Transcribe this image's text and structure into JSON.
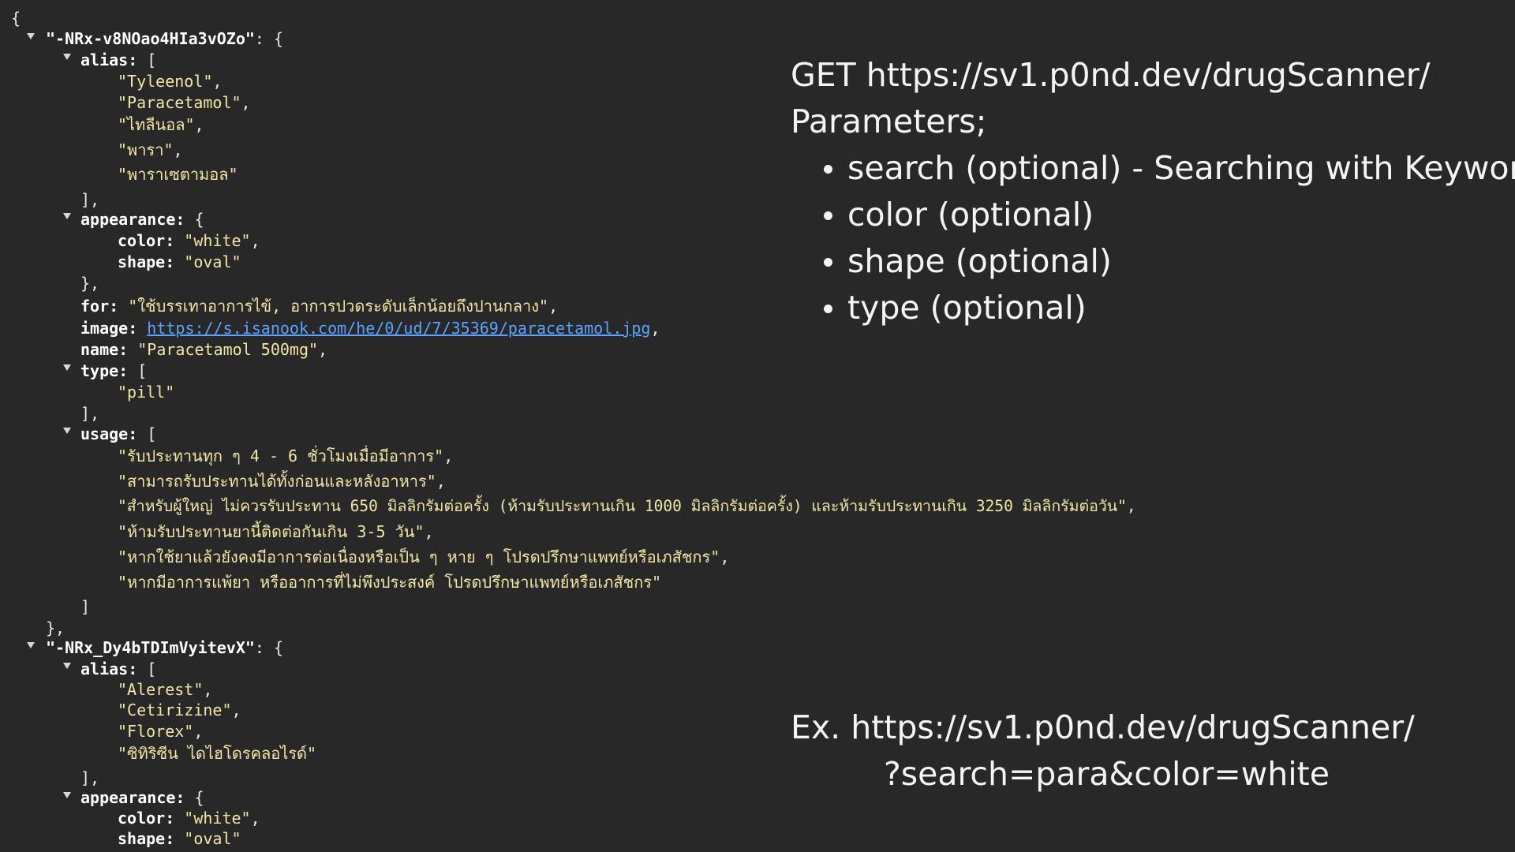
{
  "json_view": {
    "open_brace": "{",
    "entries": [
      {
        "key": "\"-NRx-v8NOao4HIa3vOZo\"",
        "alias_key": "alias:",
        "alias": [
          "\"Tyleenol\"",
          "\"Paracetamol\"",
          "\"ไทลีนอล\"",
          "\"พารา\"",
          "\"พาราเซตามอล\""
        ],
        "appearance_key": "appearance:",
        "color_key": "color:",
        "color_value": "\"white\"",
        "shape_key": "shape:",
        "shape_value": "\"oval\"",
        "for_key": "for:",
        "for_value": "\"ใช้บรรเทาอาการไข้, อาการปวดระดับเล็กน้อยถึงปานกลาง\"",
        "image_key": "image:",
        "image_value": "https://s.isanook.com/he/0/ud/7/35369/paracetamol.jpg",
        "name_key": "name:",
        "name_value": "\"Paracetamol 500mg\"",
        "type_key": "type:",
        "type": [
          "\"pill\""
        ],
        "usage_key": "usage:",
        "usage": [
          "\"รับประทานทุก ๆ 4 - 6 ชั่วโมงเมื่อมีอาการ\"",
          "\"สามารถรับประทานได้ทั้งก่อนและหลังอาหาร\"",
          "\"สำหรับผู้ใหญ่ ไม่ควรรับประทาน 650 มิลลิกรัมต่อครั้ง (ห้ามรับประทานเกิน 1000 มิลลิกรัมต่อครั้ง) และห้ามรับประทานเกิน 3250 มิลลิกรัมต่อวัน\"",
          "\"ห้ามรับประทานยานี้ติดต่อกันเกิน 3-5 วัน\"",
          "\"หากใช้ยาแล้วยังคงมีอาการต่อเนื่องหรือเป็น ๆ หาย ๆ โปรดปรึกษาแพทย์หรือเภสัชกร\"",
          "\"หากมีอาการแพ้ยา หรืออาการที่ไม่พึงประสงค์ โปรดปรึกษาแพทย์หรือเภสัชกร\""
        ]
      },
      {
        "key": "\"-NRx_Dy4bTDImVyitevX\"",
        "alias_key": "alias:",
        "alias": [
          "\"Alerest\"",
          "\"Cetirizine\"",
          "\"Florex\"",
          "\"ซิทิริซีน ไดไฮโดรคลอไรด์\""
        ],
        "appearance_key": "appearance:",
        "color_key": "color:",
        "color_value": "\"white\"",
        "shape_key": "shape:",
        "shape_value": "\"oval\""
      }
    ]
  },
  "api_doc": {
    "endpoint": "GET https://sv1.p0nd.dev/drugScanner/",
    "parameters_heading": "Parameters;",
    "parameters": [
      "search (optional) - Searching with Keyword",
      "color (optional)",
      "shape (optional)",
      "type (optional)"
    ],
    "example_line1": "Ex. https://sv1.p0nd.dev/drugScanner/",
    "example_line2": "?search=para&color=white"
  }
}
